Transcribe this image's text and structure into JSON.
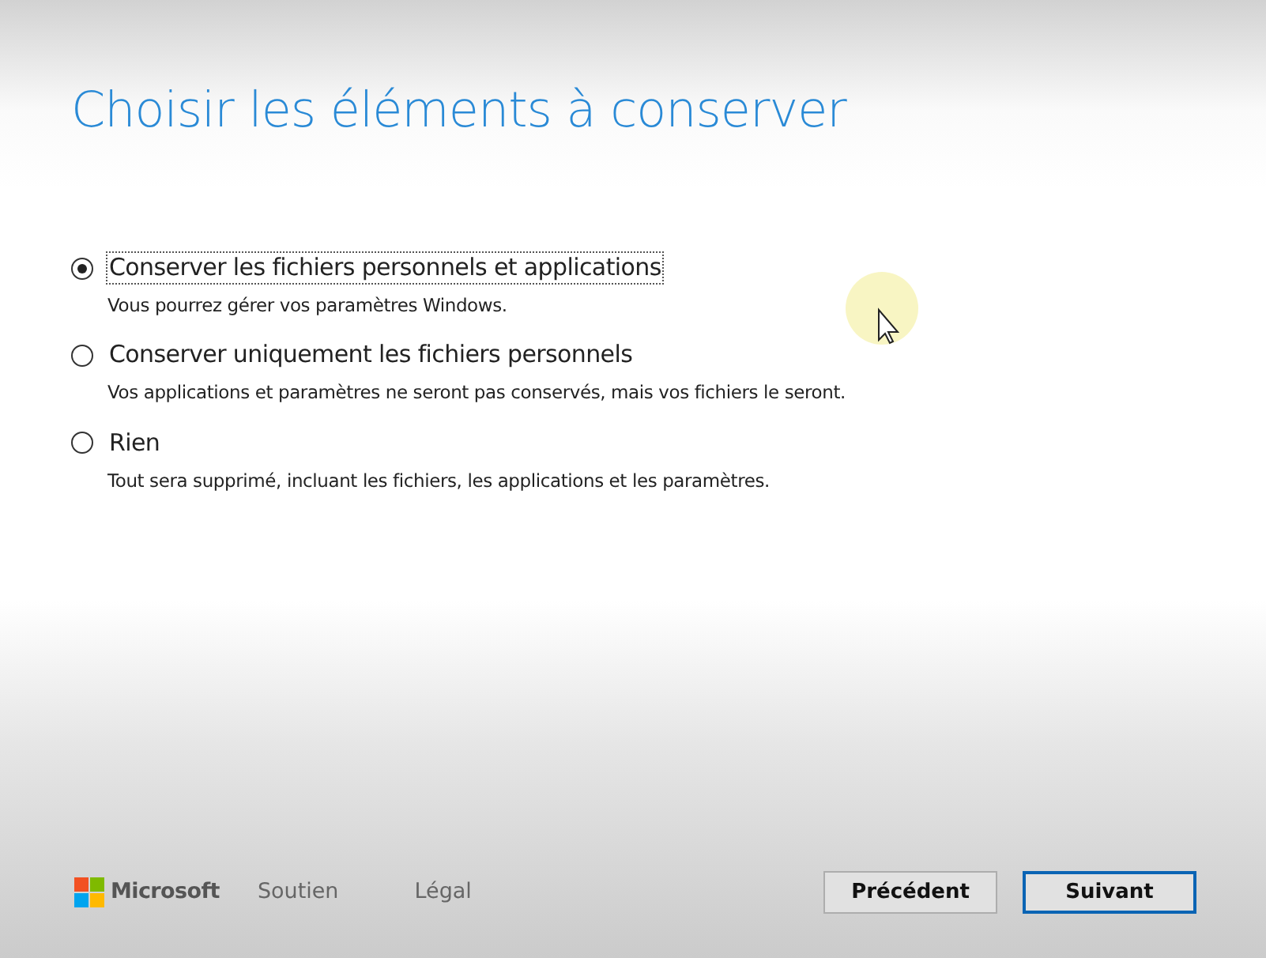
{
  "title": "Choisir les éléments à conserver",
  "options": [
    {
      "label": "Conserver les fichiers personnels et applications",
      "description": "Vous pourrez gérer vos paramètres Windows.",
      "selected": true,
      "focused": true
    },
    {
      "label": "Conserver uniquement les fichiers personnels",
      "description": "Vos applications et paramètres ne seront pas conservés, mais vos fichiers le seront.",
      "selected": false,
      "focused": false
    },
    {
      "label": "Rien",
      "description": "Tout sera supprimé, incluant les fichiers, les applications et les paramètres.",
      "selected": false,
      "focused": false
    }
  ],
  "footer": {
    "brand": "Microsoft",
    "links": [
      "Soutien",
      "Légal"
    ]
  },
  "buttons": [
    {
      "label": "Précédent",
      "default": false
    },
    {
      "label": "Suivant",
      "default": true
    }
  ]
}
